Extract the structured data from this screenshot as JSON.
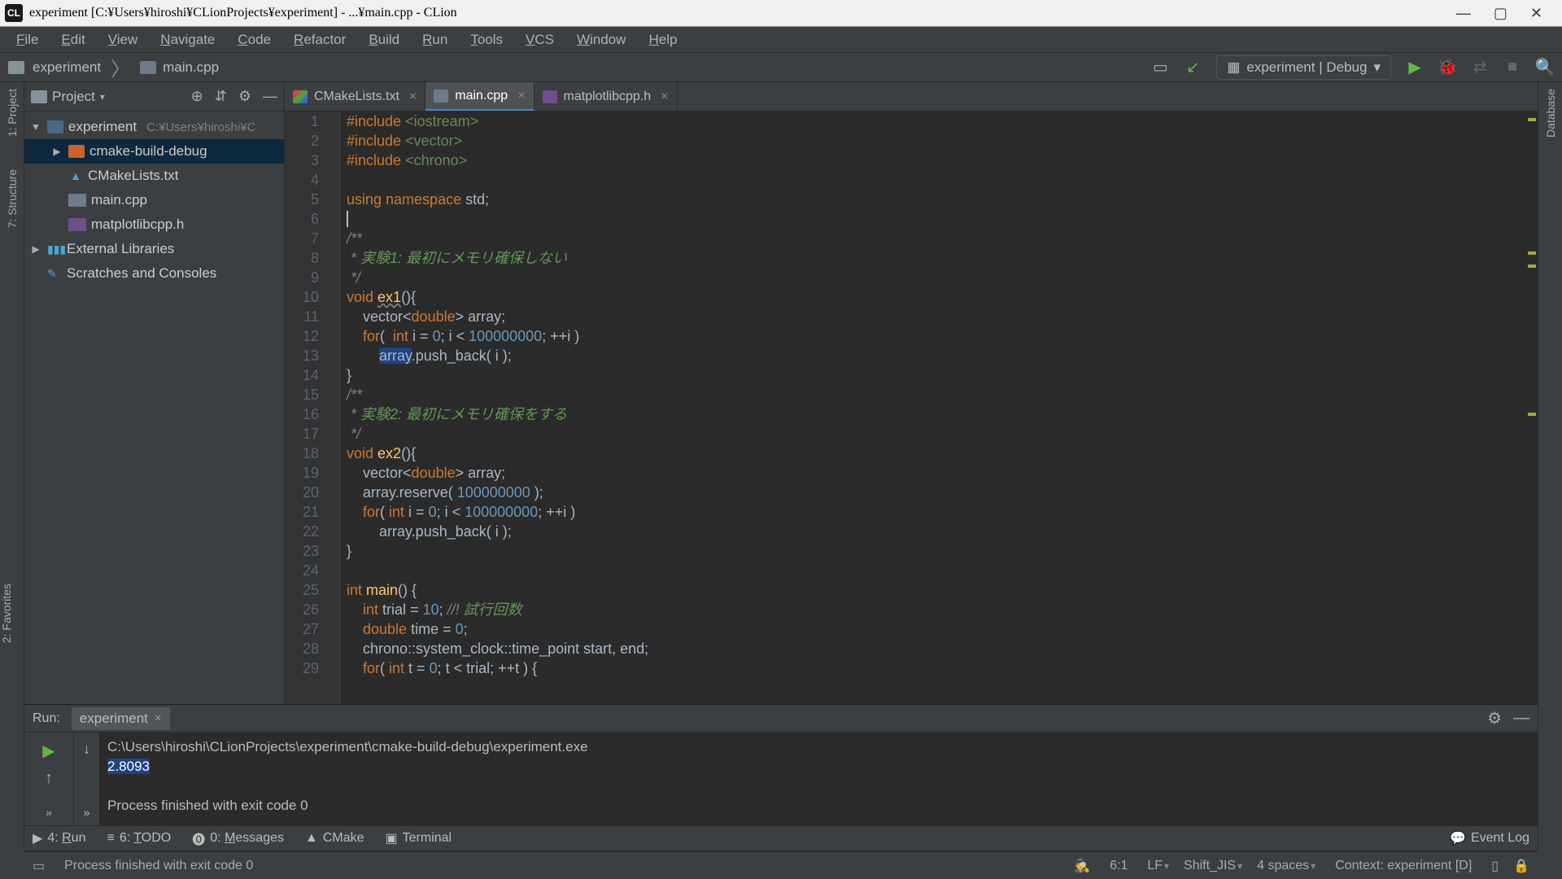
{
  "titlebar": {
    "app_icon_label": "CL",
    "title": "experiment [C:¥Users¥hiroshi¥CLionProjects¥experiment] - ...¥main.cpp - CLion"
  },
  "menu": [
    "File",
    "Edit",
    "View",
    "Navigate",
    "Code",
    "Refactor",
    "Build",
    "Run",
    "Tools",
    "VCS",
    "Window",
    "Help"
  ],
  "breadcrumb": {
    "project": "experiment",
    "file": "main.cpp"
  },
  "run_config": "experiment | Debug",
  "left_tabs": [
    "1: Project",
    "7: Structure"
  ],
  "right_tabs": [
    "Database"
  ],
  "project_header": "Project",
  "tree": {
    "root": "experiment",
    "root_path": "C:¥Users¥hiroshi¥C",
    "items": [
      {
        "indent": 1,
        "icon": "folder",
        "label": "cmake-build-debug",
        "expand": "▶",
        "selected": true
      },
      {
        "indent": 1,
        "icon": "cmake",
        "label": "CMakeLists.txt"
      },
      {
        "indent": 1,
        "icon": "cpp",
        "label": "main.cpp"
      },
      {
        "indent": 1,
        "icon": "h",
        "label": "matplotlibcpp.h"
      }
    ],
    "ext_lib": "External Libraries",
    "scratches": "Scratches and Consoles"
  },
  "tabs": [
    {
      "icon": "cmake",
      "label": "CMakeLists.txt",
      "active": false
    },
    {
      "icon": "cpp",
      "label": "main.cpp",
      "active": true
    },
    {
      "icon": "h",
      "label": "matplotlibcpp.h",
      "active": false
    }
  ],
  "code_lines": [
    {
      "n": 1,
      "html": "<span class='kw'>#include</span> <span class='str'>&lt;iostream&gt;</span>"
    },
    {
      "n": 2,
      "html": "<span class='kw'>#include</span> <span class='str'>&lt;vector&gt;</span>"
    },
    {
      "n": 3,
      "html": "<span class='kw'>#include</span> <span class='str'>&lt;chrono&gt;</span>"
    },
    {
      "n": 4,
      "html": ""
    },
    {
      "n": 5,
      "html": "<span class='kw'>using namespace</span> std;"
    },
    {
      "n": 6,
      "html": "<span class='cursor'></span>"
    },
    {
      "n": 7,
      "html": "<span class='cmt'>/**</span>"
    },
    {
      "n": 8,
      "html": "<span class='cmt'> * </span><span class='cmt-hi'>実験1: 最初にメモリ確保しない</span>"
    },
    {
      "n": 9,
      "html": "<span class='cmt'> */</span>"
    },
    {
      "n": 10,
      "html": "<span class='kw'>void</span> <span class='fn warn'>ex1</span>(){"
    },
    {
      "n": 11,
      "html": "    vector&lt;<span class='kw'>double</span>&gt; array;"
    },
    {
      "n": 12,
      "html": "    <span class='kw'>for</span>(  <span class='kw'>int</span> i = <span class='num'>0</span>; i &lt; <span class='num'>100000000</span>; ++i )"
    },
    {
      "n": 13,
      "html": "        <span class='mark'>array</span>.push_back( i );"
    },
    {
      "n": 14,
      "html": "}"
    },
    {
      "n": 15,
      "html": "<span class='cmt'>/**</span>"
    },
    {
      "n": 16,
      "html": "<span class='cmt'> * </span><span class='cmt-hi'>実験2: 最初にメモリ確保をする</span>"
    },
    {
      "n": 17,
      "html": "<span class='cmt'> */</span>"
    },
    {
      "n": 18,
      "html": "<span class='kw'>void</span> <span class='fn'>ex2</span>(){"
    },
    {
      "n": 19,
      "html": "    vector&lt;<span class='kw'>double</span>&gt; array;"
    },
    {
      "n": 20,
      "html": "    array.reserve( <span class='num'>100000000</span> );"
    },
    {
      "n": 21,
      "html": "    <span class='kw'>for</span>( <span class='kw'>int</span> i = <span class='num'>0</span>; i &lt; <span class='num'>100000000</span>; ++i )"
    },
    {
      "n": 22,
      "html": "        array.push_back( i );"
    },
    {
      "n": 23,
      "html": "}"
    },
    {
      "n": 24,
      "html": ""
    },
    {
      "n": 25,
      "html": "<span class='kw'>int</span> <span class='fn'>main</span>() {"
    },
    {
      "n": 26,
      "html": "    <span class='kw'>int</span> trial = <span class='num'>10</span>; <span class='cmt'>//!</span><span class='cmt-hi'> 試行回数</span>"
    },
    {
      "n": 27,
      "html": "    <span class='kw'>double</span> time = <span class='num'>0</span>;"
    },
    {
      "n": 28,
      "html": "    chrono::system_clock::time_point start, end;"
    },
    {
      "n": 29,
      "html": "    <span class='kw'>for</span>( <span class='kw'>int</span> t = <span class='num'>0</span>; t &lt; trial; ++t ) {"
    }
  ],
  "run": {
    "label": "Run:",
    "tab_name": "experiment",
    "out_path": "C:\\Users\\hiroshi\\CLionProjects\\experiment\\cmake-build-debug\\experiment.exe",
    "out_value": "2.8093",
    "out_exit": "Process finished with exit code 0"
  },
  "bottom_tabs": [
    {
      "icon": "▶",
      "label": "4: Run",
      "u": "R"
    },
    {
      "icon": "≡",
      "label": "6: TODO",
      "u": "T"
    },
    {
      "icon": "⓿",
      "label": "0: Messages",
      "u": "M"
    },
    {
      "icon": "▲",
      "label": "CMake"
    },
    {
      "icon": "▣",
      "label": "Terminal"
    }
  ],
  "event_log": "Event Log",
  "status": {
    "msg": "Process finished with exit code 0",
    "line_col": "6:1",
    "enc": "LF",
    "charset": "Shift_JIS",
    "indent": "4 spaces",
    "context": "Context: experiment [D]"
  },
  "left_tab_favorites": "2: Favorites"
}
